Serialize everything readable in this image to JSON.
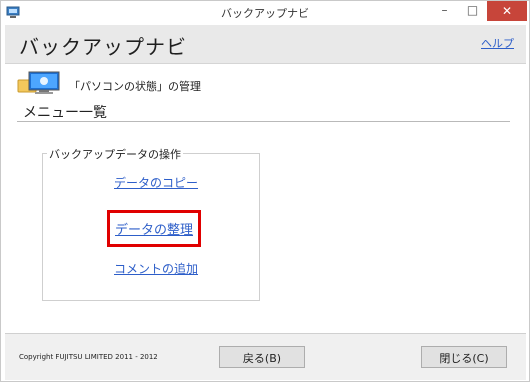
{
  "window": {
    "title": "バックアップナビ",
    "minimize_glyph": "–",
    "maximize_glyph": "□",
    "close_glyph": "✕"
  },
  "header": {
    "app_title": "バックアップナビ",
    "help_link": "ヘルプ"
  },
  "section": {
    "title": "「パソコンの状態」の管理",
    "menu_heading": "メニュー一覧"
  },
  "groupbox": {
    "legend": "バックアップデータの操作",
    "links": [
      {
        "label": "データのコピー"
      },
      {
        "label": "データの整理",
        "highlighted": true
      },
      {
        "label": "コメントの追加"
      }
    ]
  },
  "footer": {
    "copyright": "Copyright FUJITSU LIMITED 2011 - 2012",
    "back_button": "戻る(B)",
    "close_button": "閉じる(C)"
  },
  "colors": {
    "link": "#2d5ec9",
    "highlight_border": "#e00000",
    "close_button_bg": "#c7453a",
    "header_bg": "#e9e9e9"
  },
  "icons": [
    "app-icon",
    "computer-monitor-icon",
    "minimize-icon",
    "maximize-icon",
    "close-icon"
  ]
}
